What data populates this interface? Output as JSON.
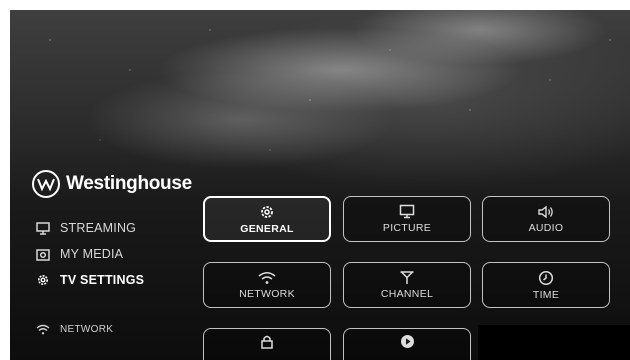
{
  "brand": {
    "name": "Westinghouse",
    "mark": "W"
  },
  "sidebar": {
    "items": [
      {
        "label": "STREAMING",
        "icon": "monitor-icon",
        "active": false
      },
      {
        "label": "MY MEDIA",
        "icon": "camera-icon",
        "active": false
      },
      {
        "label": "TV SETTINGS",
        "icon": "gear-icon",
        "active": true
      }
    ],
    "network": {
      "label": "NETWORK",
      "icon": "wifi-icon"
    }
  },
  "settings_grid": {
    "tiles": [
      {
        "label": "GENERAL",
        "icon": "gear-icon",
        "focused": true
      },
      {
        "label": "PICTURE",
        "icon": "monitor-icon",
        "focused": false
      },
      {
        "label": "AUDIO",
        "icon": "speaker-icon",
        "focused": false
      },
      {
        "label": "NETWORK",
        "icon": "wifi-icon",
        "focused": false
      },
      {
        "label": "CHANNEL",
        "icon": "antenna-icon",
        "focused": false
      },
      {
        "label": "TIME",
        "icon": "clock-icon",
        "focused": false
      },
      {
        "label": "",
        "icon": "lock-icon",
        "focused": false
      },
      {
        "label": "",
        "icon": "play-circle-icon",
        "focused": false
      }
    ]
  }
}
